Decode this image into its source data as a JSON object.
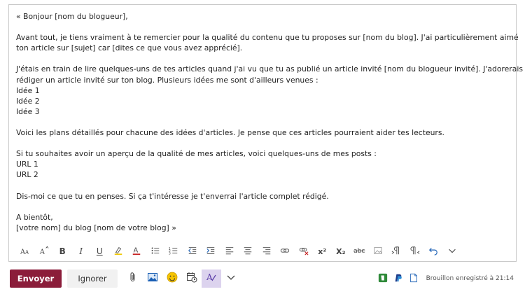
{
  "email": {
    "lines": [
      "« Bonjour [nom du blogueur],",
      "",
      "Avant tout, je tiens vraiment à te remercier pour la qualité du contenu que tu proposes sur [nom du blog]. J'ai particulièrement aimé",
      "ton article sur [sujet] car [dites ce que vous avez apprécié].",
      "",
      "J'étais en train de lire quelques-uns de tes articles quand j'ai vu que tu as publié un article invité [nom du blogueur invité]. J'adorerais",
      "rédiger un article invité sur ton blog. Plusieurs idées me sont d'ailleurs venues :",
      "Idée 1",
      "Idée 2",
      "Idée 3",
      "",
      "Voici les plans détaillés pour chacune des idées d'articles. Je pense que ces articles pourraient aider tes lecteurs.",
      "",
      "Si tu souhaites avoir un aperçu de la qualité de mes articles, voici quelques-uns de mes posts :",
      "URL 1",
      "URL 2",
      "",
      "Dis-moi ce que tu en penses. Si ça t'intéresse je t'enverrai l'article complet rédigé.",
      "",
      "A bientôt,",
      "[votre nom] du blog [nom de votre blog] »"
    ]
  },
  "toolbar": {
    "buttons": [
      {
        "name": "font-size-icon"
      },
      {
        "name": "grow-font-icon"
      },
      {
        "name": "bold-icon"
      },
      {
        "name": "italic-icon"
      },
      {
        "name": "underline-icon"
      },
      {
        "name": "highlight-icon"
      },
      {
        "name": "font-color-icon"
      },
      {
        "name": "bullets-icon"
      },
      {
        "name": "numbering-icon"
      },
      {
        "name": "decrease-indent-icon"
      },
      {
        "name": "increase-indent-icon"
      },
      {
        "name": "align-left-icon"
      },
      {
        "name": "align-center-icon"
      },
      {
        "name": "align-right-icon"
      },
      {
        "name": "link-icon"
      },
      {
        "name": "remove-link-icon"
      },
      {
        "name": "superscript-icon"
      },
      {
        "name": "subscript-icon"
      },
      {
        "name": "strikethrough-icon"
      },
      {
        "name": "insert-image-inline-icon"
      },
      {
        "name": "ltr-icon"
      },
      {
        "name": "rtl-icon"
      },
      {
        "name": "undo-icon"
      },
      {
        "name": "more-options-icon"
      }
    ],
    "bold_label": "B",
    "italic_label": "I",
    "underline_label": "U",
    "strikethrough_label": "abc",
    "superscript_label": "x²",
    "subscript_label": "X₂"
  },
  "actions": {
    "send_label": "Envoyer",
    "ignore_label": "Ignorer",
    "draft_status": "Brouillon enregistré à 21:14"
  },
  "colors": {
    "send_bg": "#8b1d3a",
    "format_active_bg": "#dcd3ee",
    "icon_gray": "#444444"
  }
}
